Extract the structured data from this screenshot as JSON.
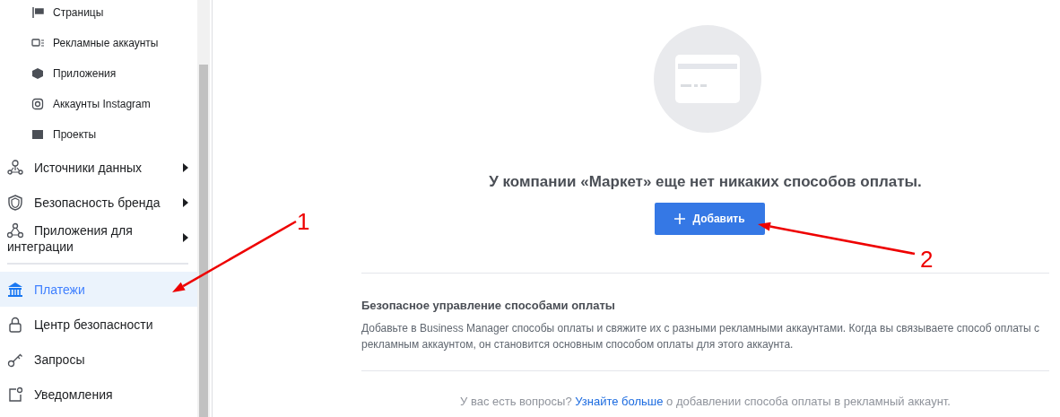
{
  "sidebar": {
    "items": [
      {
        "label": "Страницы",
        "kind": "sub",
        "has_submenu": false,
        "selected": false
      },
      {
        "label": "Рекламные аккаунты",
        "kind": "sub",
        "has_submenu": false,
        "selected": false
      },
      {
        "label": "Приложения",
        "kind": "sub",
        "has_submenu": false,
        "selected": false
      },
      {
        "label": "Аккаунты Instagram",
        "kind": "sub",
        "has_submenu": false,
        "selected": false
      },
      {
        "label": "Проекты",
        "kind": "sub",
        "has_submenu": false,
        "selected": false
      },
      {
        "label": "Источники данных",
        "kind": "main",
        "has_submenu": true,
        "selected": false
      },
      {
        "label": "Безопасность бренда",
        "kind": "main",
        "has_submenu": true,
        "selected": false
      },
      {
        "label": "Приложения для интеграции",
        "kind": "main",
        "has_submenu": true,
        "selected": false,
        "divider_after": true
      },
      {
        "label": "Платежи",
        "kind": "main",
        "has_submenu": false,
        "selected": true
      },
      {
        "label": "Центр безопасности",
        "kind": "main",
        "has_submenu": false,
        "selected": false
      },
      {
        "label": "Запросы",
        "kind": "main",
        "has_submenu": false,
        "selected": false
      },
      {
        "label": "Уведомления",
        "kind": "main",
        "has_submenu": false,
        "selected": false
      }
    ]
  },
  "empty_state": {
    "message": "У компании «Маркет» еще нет никаких способов оплаты.",
    "button": "Добавить"
  },
  "info": {
    "title": "Безопасное управление способами оплаты",
    "text": "Добавьте в Business Manager способы оплаты и свяжите их с разными рекламными аккаунтами. Когда вы связываете способ оплаты с рекламным аккаунтом, он становится основным способом оплаты для этого аккаунта."
  },
  "footer": {
    "before": "У вас есть вопросы?",
    "link": "Узнайте больше",
    "after": "о добавлении способа оплаты в рекламный аккаунт."
  },
  "annotations": [
    {
      "label": "1"
    },
    {
      "label": "2"
    }
  ]
}
